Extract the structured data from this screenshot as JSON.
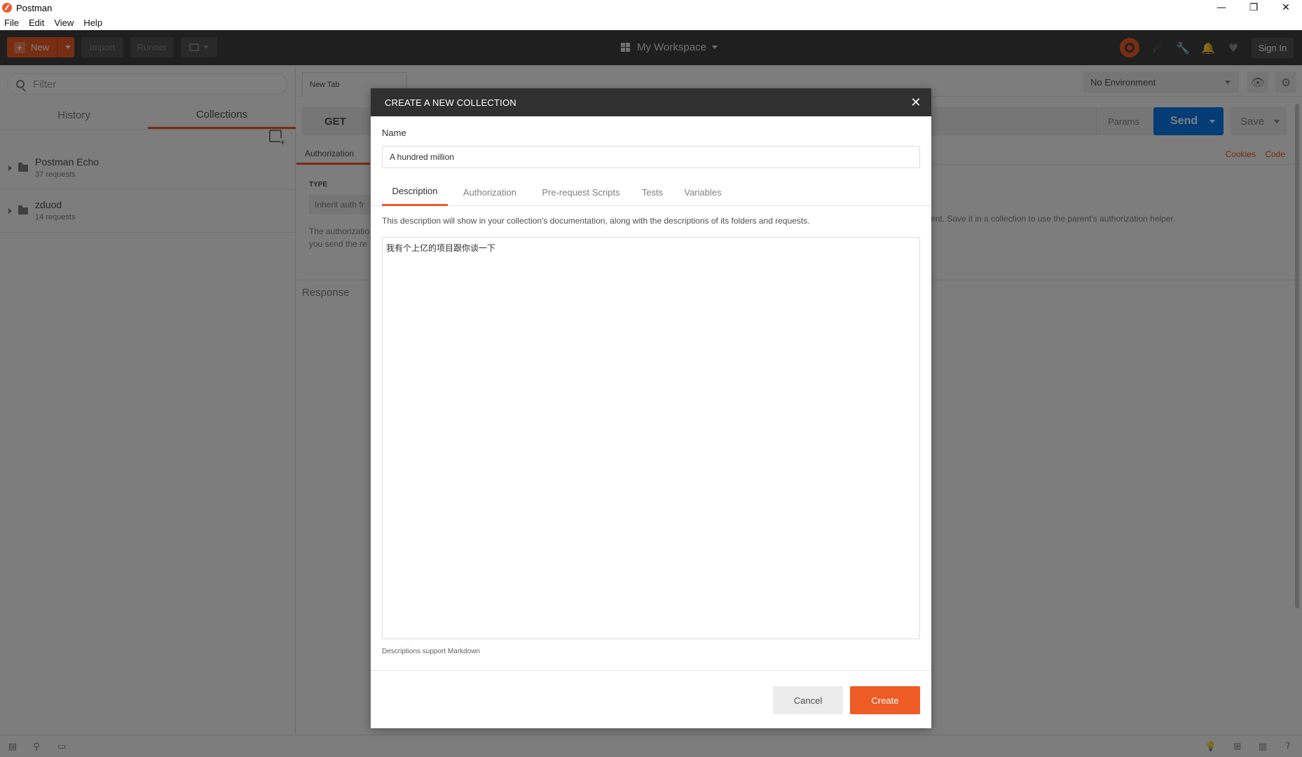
{
  "app": {
    "title": "Postman",
    "window_controls": {
      "minimize": "—",
      "maximize": "❐",
      "close": "✕"
    }
  },
  "menu": [
    "File",
    "Edit",
    "View",
    "Help"
  ],
  "header": {
    "new_label": "New",
    "import_label": "Import",
    "runner_label": "Runner",
    "workspace_label": "My Workspace",
    "signin_label": "Sign In",
    "icons": [
      "sync-icon",
      "satellite-icon",
      "wrench-icon",
      "bell-icon",
      "heart-icon"
    ],
    "brand_color": "#ef5b25"
  },
  "sidebar": {
    "filter_placeholder": "Filter",
    "tabs": [
      "History",
      "Collections"
    ],
    "active_tab": "Collections",
    "collections": [
      {
        "name": "Postman Echo",
        "count": "37 requests"
      },
      {
        "name": "zduod",
        "count": "14 requests"
      }
    ]
  },
  "main": {
    "tab_label": "New Tab",
    "environment": "No Environment",
    "method": "GET",
    "params_label": "Params",
    "send_label": "Send",
    "save_label": "Save",
    "subtab_label": "Authorization",
    "links": {
      "cookies": "Cookies",
      "code": "Code"
    },
    "type_label": "TYPE",
    "inherit_label": "Inherit auth fr",
    "auth_text_left": "The authorizatio you send the re",
    "auth_text_right": "ent. Save it in a collection to use the parent's authorization helper.",
    "response_label": "Response",
    "send_color": "#097bed"
  },
  "modal": {
    "title": "CREATE A NEW COLLECTION",
    "name_label": "Name",
    "name_value": "A hundred million",
    "tabs": [
      "Description",
      "Authorization",
      "Pre-request Scripts",
      "Tests",
      "Variables"
    ],
    "active_tab": "Description",
    "description_info": "This description will show in your collection's documentation, along with the descriptions of its folders and requests.",
    "description_value": "我有个上亿的项目跟你谈一下",
    "markdown_note": "Descriptions support Markdown",
    "cancel_label": "Cancel",
    "create_label": "Create"
  }
}
